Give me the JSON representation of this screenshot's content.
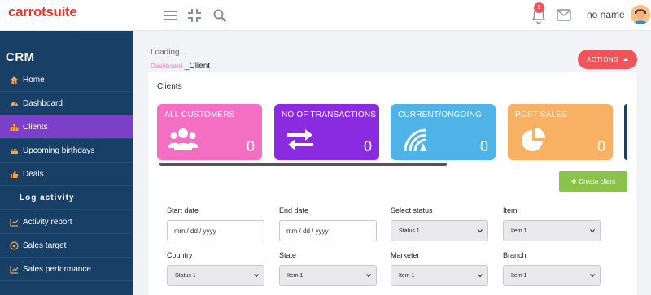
{
  "brand": {
    "name": "carrotsuite",
    "tagline": "",
    "colors": {
      "accent": "#f0545b",
      "sidebar": "#183f66",
      "active": "#7c3fc8"
    }
  },
  "header": {
    "icons": [
      "menu-icon",
      "collapse-icon",
      "search-icon",
      "bell-icon",
      "mail-icon"
    ],
    "notification_count": "5",
    "user_name": "no name"
  },
  "sidebar": {
    "title": "CRM",
    "items": [
      {
        "label": "Home",
        "icon": "home-icon"
      },
      {
        "label": "Dashboard",
        "icon": "dashboard-icon"
      },
      {
        "label": "Clients",
        "icon": "clients-icon",
        "active": true
      },
      {
        "label": "Upcoming birthdays",
        "icon": "cake-icon"
      },
      {
        "label": "Deals",
        "icon": "thumbs-up-icon"
      },
      {
        "label": "Log activity",
        "icon": ""
      },
      {
        "label": "Activity report",
        "icon": "chart-icon"
      },
      {
        "label": "Sales target",
        "icon": "target-icon"
      },
      {
        "label": "Sales performance",
        "icon": "line-chart-icon"
      }
    ]
  },
  "page": {
    "status": "Loading...",
    "breadcrumb": {
      "parent": "Dashboard",
      "current": "_Client"
    },
    "actions_label": "ACTIONS",
    "panel_title": "Clients",
    "create_label": "Create client"
  },
  "cards": [
    {
      "label": "ALL CUSTOMERS",
      "value": "0",
      "color": "#f36fc4",
      "icon": "users-icon"
    },
    {
      "label": "NO OF TRANSACTIONS",
      "value": "0",
      "color": "#8a2be2",
      "icon": "transfer-icon"
    },
    {
      "label": "CURRENT/ONGOING",
      "value": "0",
      "color": "#4fb3e8",
      "icon": "ongoing-icon"
    },
    {
      "label": "POST SALES",
      "value": "0",
      "color": "#f7b064",
      "icon": "pie-icon"
    }
  ],
  "filters": {
    "start_date": {
      "label": "Start date",
      "placeholder": "mm / dd / yyyy"
    },
    "end_date": {
      "label": "End date",
      "placeholder": "mm / dd / yyyy"
    },
    "status": {
      "label": "Select status",
      "value": "Status 1"
    },
    "item": {
      "label": "Item",
      "value": "Item 1"
    },
    "country": {
      "label": "Country",
      "value": "Status 1"
    },
    "state": {
      "label": "State",
      "value": "Item 1"
    },
    "marketer": {
      "label": "Marketer",
      "value": "Item 1"
    },
    "branch": {
      "label": "Branch",
      "value": "Item 1"
    }
  }
}
